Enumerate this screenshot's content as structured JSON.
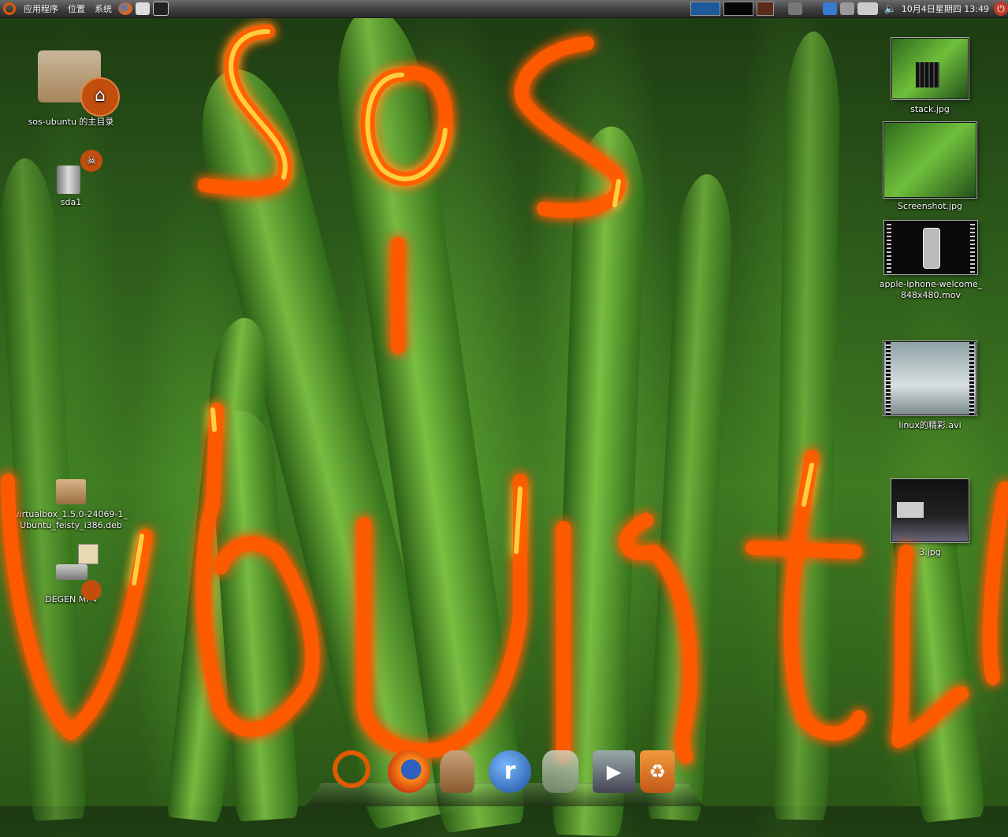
{
  "top_panel": {
    "menus": [
      "应用程序",
      "位置",
      "系统"
    ],
    "clock": "10月4日星期四 13:49"
  },
  "desktop_icons_left": [
    {
      "label": "sos-ubuntu 的主目录"
    },
    {
      "label": "sda1"
    },
    {
      "label_line1": "virtualbox_1.5.0-24069-1_",
      "label_line2": "Ubuntu_feisty_i386.deb"
    },
    {
      "label": "DEGEN MP4"
    }
  ],
  "desktop_icons_right": [
    {
      "label": "stack.jpg"
    },
    {
      "label": "Screenshot.jpg"
    },
    {
      "label_line1": "apple-iphone-welcome_",
      "label_line2": "848x480.mov"
    },
    {
      "label": "linux的精彩.avi"
    },
    {
      "label": "3.jpg"
    }
  ],
  "wallpaper_text": "sos ubuntu",
  "dock_items": [
    "ubuntu-icon",
    "firefox-icon",
    "rabbit-icon",
    "realplayer-icon",
    "pidgin-icon",
    "media-player-icon",
    "trash-icon"
  ],
  "colors": {
    "fire": "#ff6a00",
    "fire_core": "#ffe24a",
    "panel": "#3c3c3c"
  }
}
